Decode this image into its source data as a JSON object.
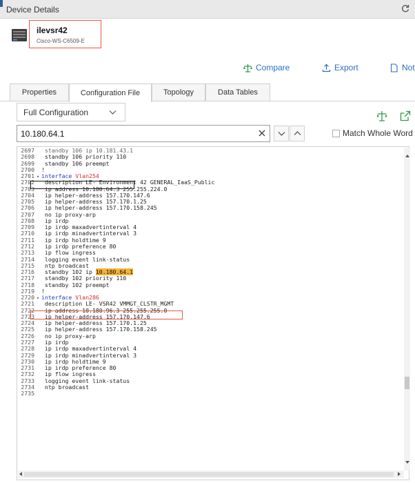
{
  "window": {
    "title": "Device Details",
    "refresh_icon": "refresh-icon"
  },
  "device": {
    "name": "ilevsr42",
    "model": "Cisco-WS-C6509-E",
    "thumbnail_icon": "network-device-icon"
  },
  "actions": [
    {
      "label": "Compare",
      "icon": "compare-icon"
    },
    {
      "label": "Export",
      "icon": "export-icon"
    },
    {
      "label": "Not",
      "icon": "note-icon"
    }
  ],
  "tabs": [
    {
      "label": "Properties",
      "active": false
    },
    {
      "label": "Configuration File",
      "active": true
    },
    {
      "label": "Topology",
      "active": false
    },
    {
      "label": "Data Tables",
      "active": false
    }
  ],
  "config": {
    "selected": "Full Configuration",
    "search_value": "10.180.64.1",
    "match_whole_word_label": "Match Whole Word"
  },
  "code_lines": [
    {
      "n": "2697",
      "t": " standby 106 ip 10.181.43.1"
    },
    {
      "n": "2698",
      "t": " standby 106 priority 110"
    },
    {
      "n": "2699",
      "t": " standby 106 preempt"
    },
    {
      "n": "2700",
      "t": "!"
    },
    {
      "n": "2701",
      "fold": true,
      "kw": "interface ",
      "vlan": "Vlan254"
    },
    {
      "n": "2702",
      "t": " description LE- Environment 42 GENERAL_IaaS_Public"
    },
    {
      "n": "2703",
      "t": " ip address 10.180.64.3 255.255.224.0"
    },
    {
      "n": "2704",
      "t": " ip helper-address 157.170.147.6"
    },
    {
      "n": "2705",
      "t": " ip helper-address 157.170.1.25"
    },
    {
      "n": "2706",
      "t": " ip helper-address 157.170.158.245"
    },
    {
      "n": "2707",
      "t": " no ip proxy-arp"
    },
    {
      "n": "2708",
      "t": " ip irdp"
    },
    {
      "n": "2709",
      "t": " ip irdp maxadvertinterval 4"
    },
    {
      "n": "2710",
      "t": " ip irdp minadvertinterval 3"
    },
    {
      "n": "2711",
      "t": " ip irdp holdtime 9"
    },
    {
      "n": "2712",
      "t": " ip irdp preference 80"
    },
    {
      "n": "2713",
      "t": " ip flow ingress"
    },
    {
      "n": "2714",
      "t": " logging event link-status"
    },
    {
      "n": "2715",
      "t": " ntp broadcast"
    },
    {
      "n": "2716",
      "t": " standby 102 ip ",
      "hl": "10.180.64.1"
    },
    {
      "n": "2717",
      "t": " standby 102 priority 110"
    },
    {
      "n": "2718",
      "t": " standby 102 preempt"
    },
    {
      "n": "2719",
      "t": "!"
    },
    {
      "n": "2720",
      "fold": true,
      "kw": "interface ",
      "vlan": "Vlan286"
    },
    {
      "n": "2721",
      "t": " description LE- VSR42 VMMGT_CLSTR_MGMT"
    },
    {
      "n": "2722",
      "t": " ip address 10.180.96.3 255.255.255.0"
    },
    {
      "n": "2723",
      "t": " ip helper-address 157.170.147.6"
    },
    {
      "n": "2724",
      "t": " ip helper-address 157.170.1.25"
    },
    {
      "n": "2725",
      "t": " ip helper-address 157.170.158.245"
    },
    {
      "n": "2726",
      "t": " no ip proxy-arp"
    },
    {
      "n": "2727",
      "t": " ip irdp"
    },
    {
      "n": "2728",
      "t": " ip irdp maxadvertinterval 4"
    },
    {
      "n": "2729",
      "t": " ip irdp minadvertinterval 3"
    },
    {
      "n": "2730",
      "t": " ip irdp holdtime 9"
    },
    {
      "n": "2731",
      "t": " ip irdp preference 80"
    },
    {
      "n": "2732",
      "t": " ip flow ingress"
    },
    {
      "n": "2733",
      "t": " logging event link-status"
    },
    {
      "n": "2734",
      "t": " ntp broadcast"
    },
    {
      "n": "2735",
      "t": ""
    }
  ],
  "colors": {
    "accent_link": "#2a6fc2",
    "annotation_red": "#e8573b",
    "annotation_black": "#111111",
    "keyword_blue": "#1f3ac0",
    "vlan_red": "#d03030",
    "highlight": "#f5b335"
  }
}
